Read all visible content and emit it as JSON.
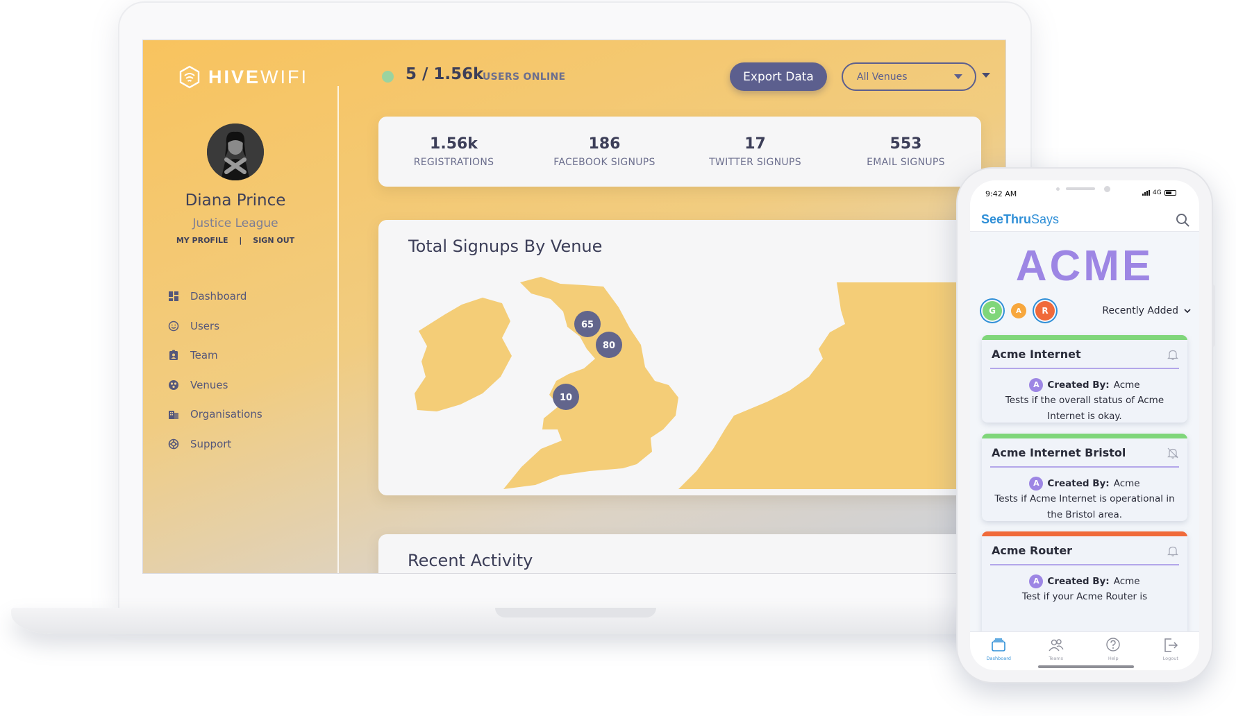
{
  "dashboard": {
    "brand": {
      "name_bold": "HIVE",
      "name_light": "WIFI"
    },
    "user": {
      "name": "Diana Prince",
      "org": "Justice League",
      "my_profile": "MY PROFILE",
      "separator": "|",
      "sign_out": "SIGN OUT"
    },
    "nav": [
      {
        "label": "Dashboard",
        "icon": "dashboard-icon"
      },
      {
        "label": "Users",
        "icon": "smiley-icon"
      },
      {
        "label": "Team",
        "icon": "badge-icon"
      },
      {
        "label": "Venues",
        "icon": "venue-icon"
      },
      {
        "label": "Organisations",
        "icon": "building-icon"
      },
      {
        "label": "Support",
        "icon": "lifebuoy-icon"
      }
    ],
    "header": {
      "online_count": "5 / 1.56k",
      "online_label": "USERS ONLINE",
      "export_label": "Export Data",
      "venue_selected": "All Venues"
    },
    "stats": [
      {
        "value": "1.56k",
        "label": "REGISTRATIONS"
      },
      {
        "value": "186",
        "label": "FACEBOOK SIGNUPS"
      },
      {
        "value": "17",
        "label": "TWITTER SIGNUPS"
      },
      {
        "value": "553",
        "label": "EMAIL SIGNUPS"
      }
    ],
    "map": {
      "title": "Total Signups By Venue",
      "markers": [
        "65",
        "80",
        "10"
      ]
    },
    "activity": {
      "title": "Recent Activity"
    },
    "colors": {
      "accent": "#5c5f8e",
      "map_land": "#f4cd77",
      "marker": "#62658c"
    }
  },
  "phone": {
    "status": {
      "time": "9:42 AM",
      "network": "4G"
    },
    "app_logo": {
      "part1": "SeeThru",
      "part2": "Says"
    },
    "title": "ACME",
    "filters": {
      "g": "G",
      "a": "A",
      "r": "R"
    },
    "sort_label": "Recently Added",
    "cards": [
      {
        "title": "Acme Internet",
        "status_color": "#7fd67a",
        "bell": "bell-icon",
        "badge": "A",
        "created_label": "Created By:",
        "created_by": "Acme",
        "description": "Tests if the overall status of Acme Internet is okay."
      },
      {
        "title": "Acme Internet Bristol",
        "status_color": "#7fd67a",
        "bell": "bell-off-icon",
        "badge": "A",
        "created_label": "Created By:",
        "created_by": "Acme",
        "description": "Tests if Acme Internet is operational in the Bristol area."
      },
      {
        "title": "Acme Router",
        "status_color": "#f06a3a",
        "bell": "bell-icon",
        "badge": "A",
        "created_label": "Created By:",
        "created_by": "Acme",
        "description": "Test if your Acme Router is"
      }
    ],
    "tabs": [
      {
        "label": "Dashboard",
        "icon": "dashboard-tab-icon"
      },
      {
        "label": "Teams",
        "icon": "teams-icon"
      },
      {
        "label": "Help",
        "icon": "help-icon"
      },
      {
        "label": "Logout",
        "icon": "logout-icon"
      }
    ]
  }
}
